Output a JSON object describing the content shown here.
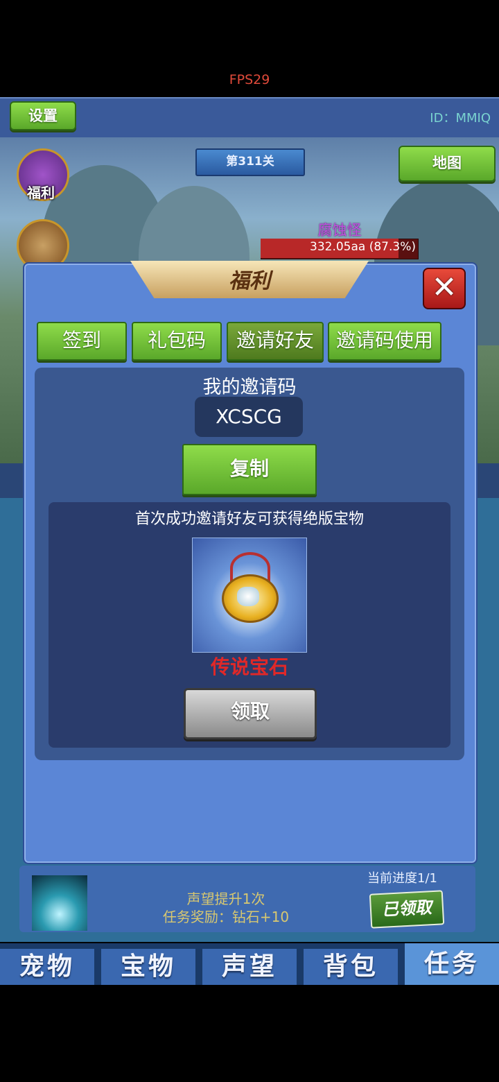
{
  "fps": "FPS29",
  "header": {
    "settings_label": "设置",
    "player_id": "ID：MMIQ"
  },
  "scene": {
    "level": "第311关",
    "map_label": "地图",
    "welfare_label": "福利",
    "monster_name": "腐蚀怪",
    "monster_hp": "332.05aa (87.3%)",
    "monster_hp_fraction": 0.873
  },
  "dialog": {
    "title": "福利",
    "close_symbol": "✕",
    "tabs": [
      {
        "label": "签到"
      },
      {
        "label": "礼包码"
      },
      {
        "label": "邀请好友"
      },
      {
        "label": "邀请码使用"
      }
    ],
    "active_tab": "邀请好友",
    "my_code_label": "我的邀请码",
    "my_code": "XCSCG",
    "copy_label": "复制",
    "reward_desc": "首次成功邀请好友可获得绝版宝物",
    "treasure_name": "传说宝石",
    "claim_label": "领取"
  },
  "task": {
    "progress": "当前进度1/1",
    "line1": "声望提升1次",
    "line2": "任务奖励：钻石+10",
    "claimed_label": "已领取"
  },
  "bottom_nav": [
    {
      "label": "宠物"
    },
    {
      "label": "宝物"
    },
    {
      "label": "声望"
    },
    {
      "label": "背包"
    },
    {
      "label": "任务"
    }
  ],
  "colors": {
    "accent_green": "#6cc236",
    "dialog_blue": "#5b86d6",
    "red_text": "#e02828"
  }
}
